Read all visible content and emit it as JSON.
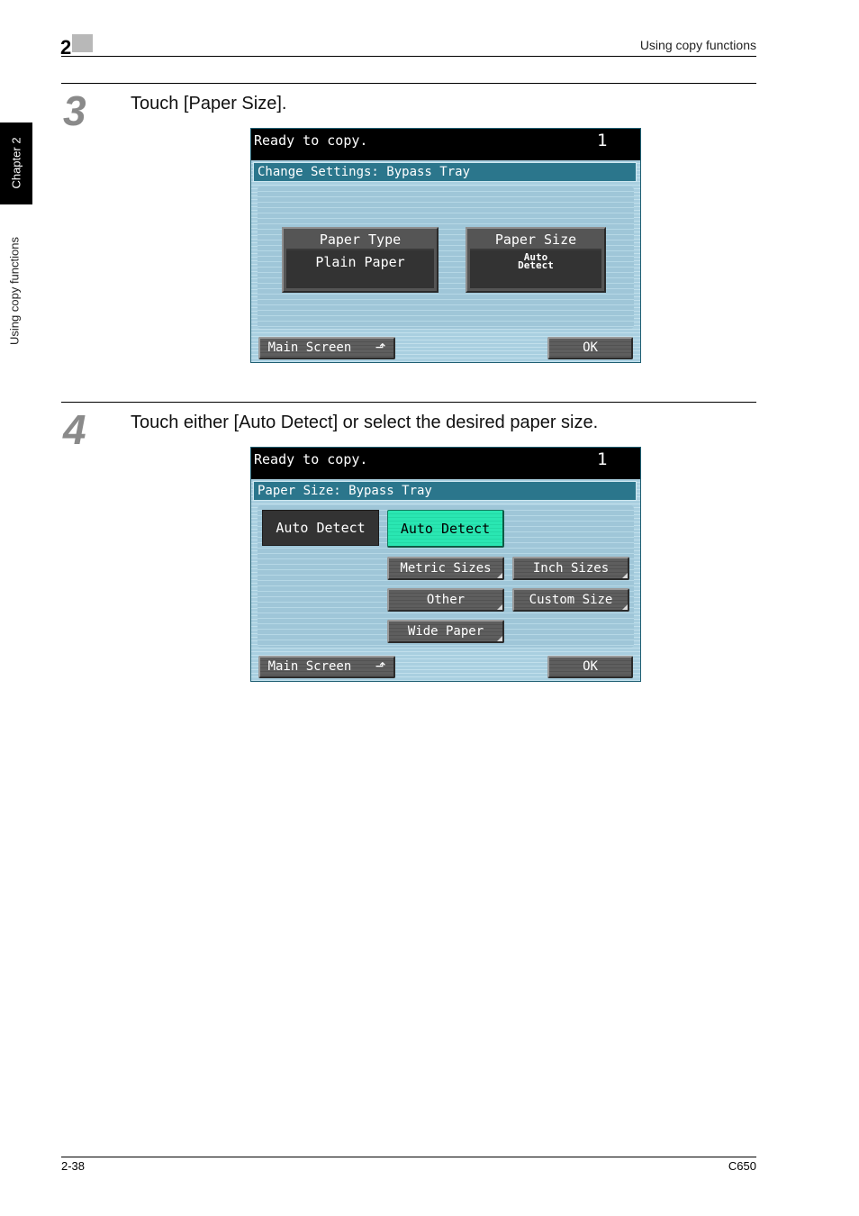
{
  "header": {
    "chapter_number": "2",
    "section_title": "Using copy functions"
  },
  "side_tab": {
    "chapter_label": "Chapter 2",
    "section_label": "Using copy functions"
  },
  "steps": [
    {
      "number": "3",
      "instruction": "Touch [Paper Size].",
      "screen": {
        "status": "Ready to copy.",
        "copy_count": "1",
        "title": "Change Settings: Bypass Tray",
        "settings": [
          {
            "label": "Paper Type",
            "value": "Plain Paper"
          },
          {
            "label": "Paper Size",
            "value_line1": "Auto",
            "value_line2": "Detect"
          }
        ],
        "main_screen_label": "Main Screen",
        "ok_label": "OK"
      }
    },
    {
      "number": "4",
      "instruction": "Touch either [Auto Detect] or select the desired paper size.",
      "screen": {
        "status": "Ready to copy.",
        "copy_count": "1",
        "title": "Paper Size: Bypass Tray",
        "current_value": "Auto Detect",
        "auto_detect_label": "Auto Detect",
        "options": [
          "Metric Sizes",
          "Inch Sizes",
          "Other",
          "Custom Size",
          "Wide Paper"
        ],
        "main_screen_label": "Main Screen",
        "ok_label": "OK"
      }
    }
  ],
  "footer": {
    "page_number": "2-38",
    "model": "C650"
  },
  "colors": {
    "selected_button": "#2ae6b2",
    "title_bar": "#2b768c",
    "panel_background": "#a9cfe0"
  }
}
